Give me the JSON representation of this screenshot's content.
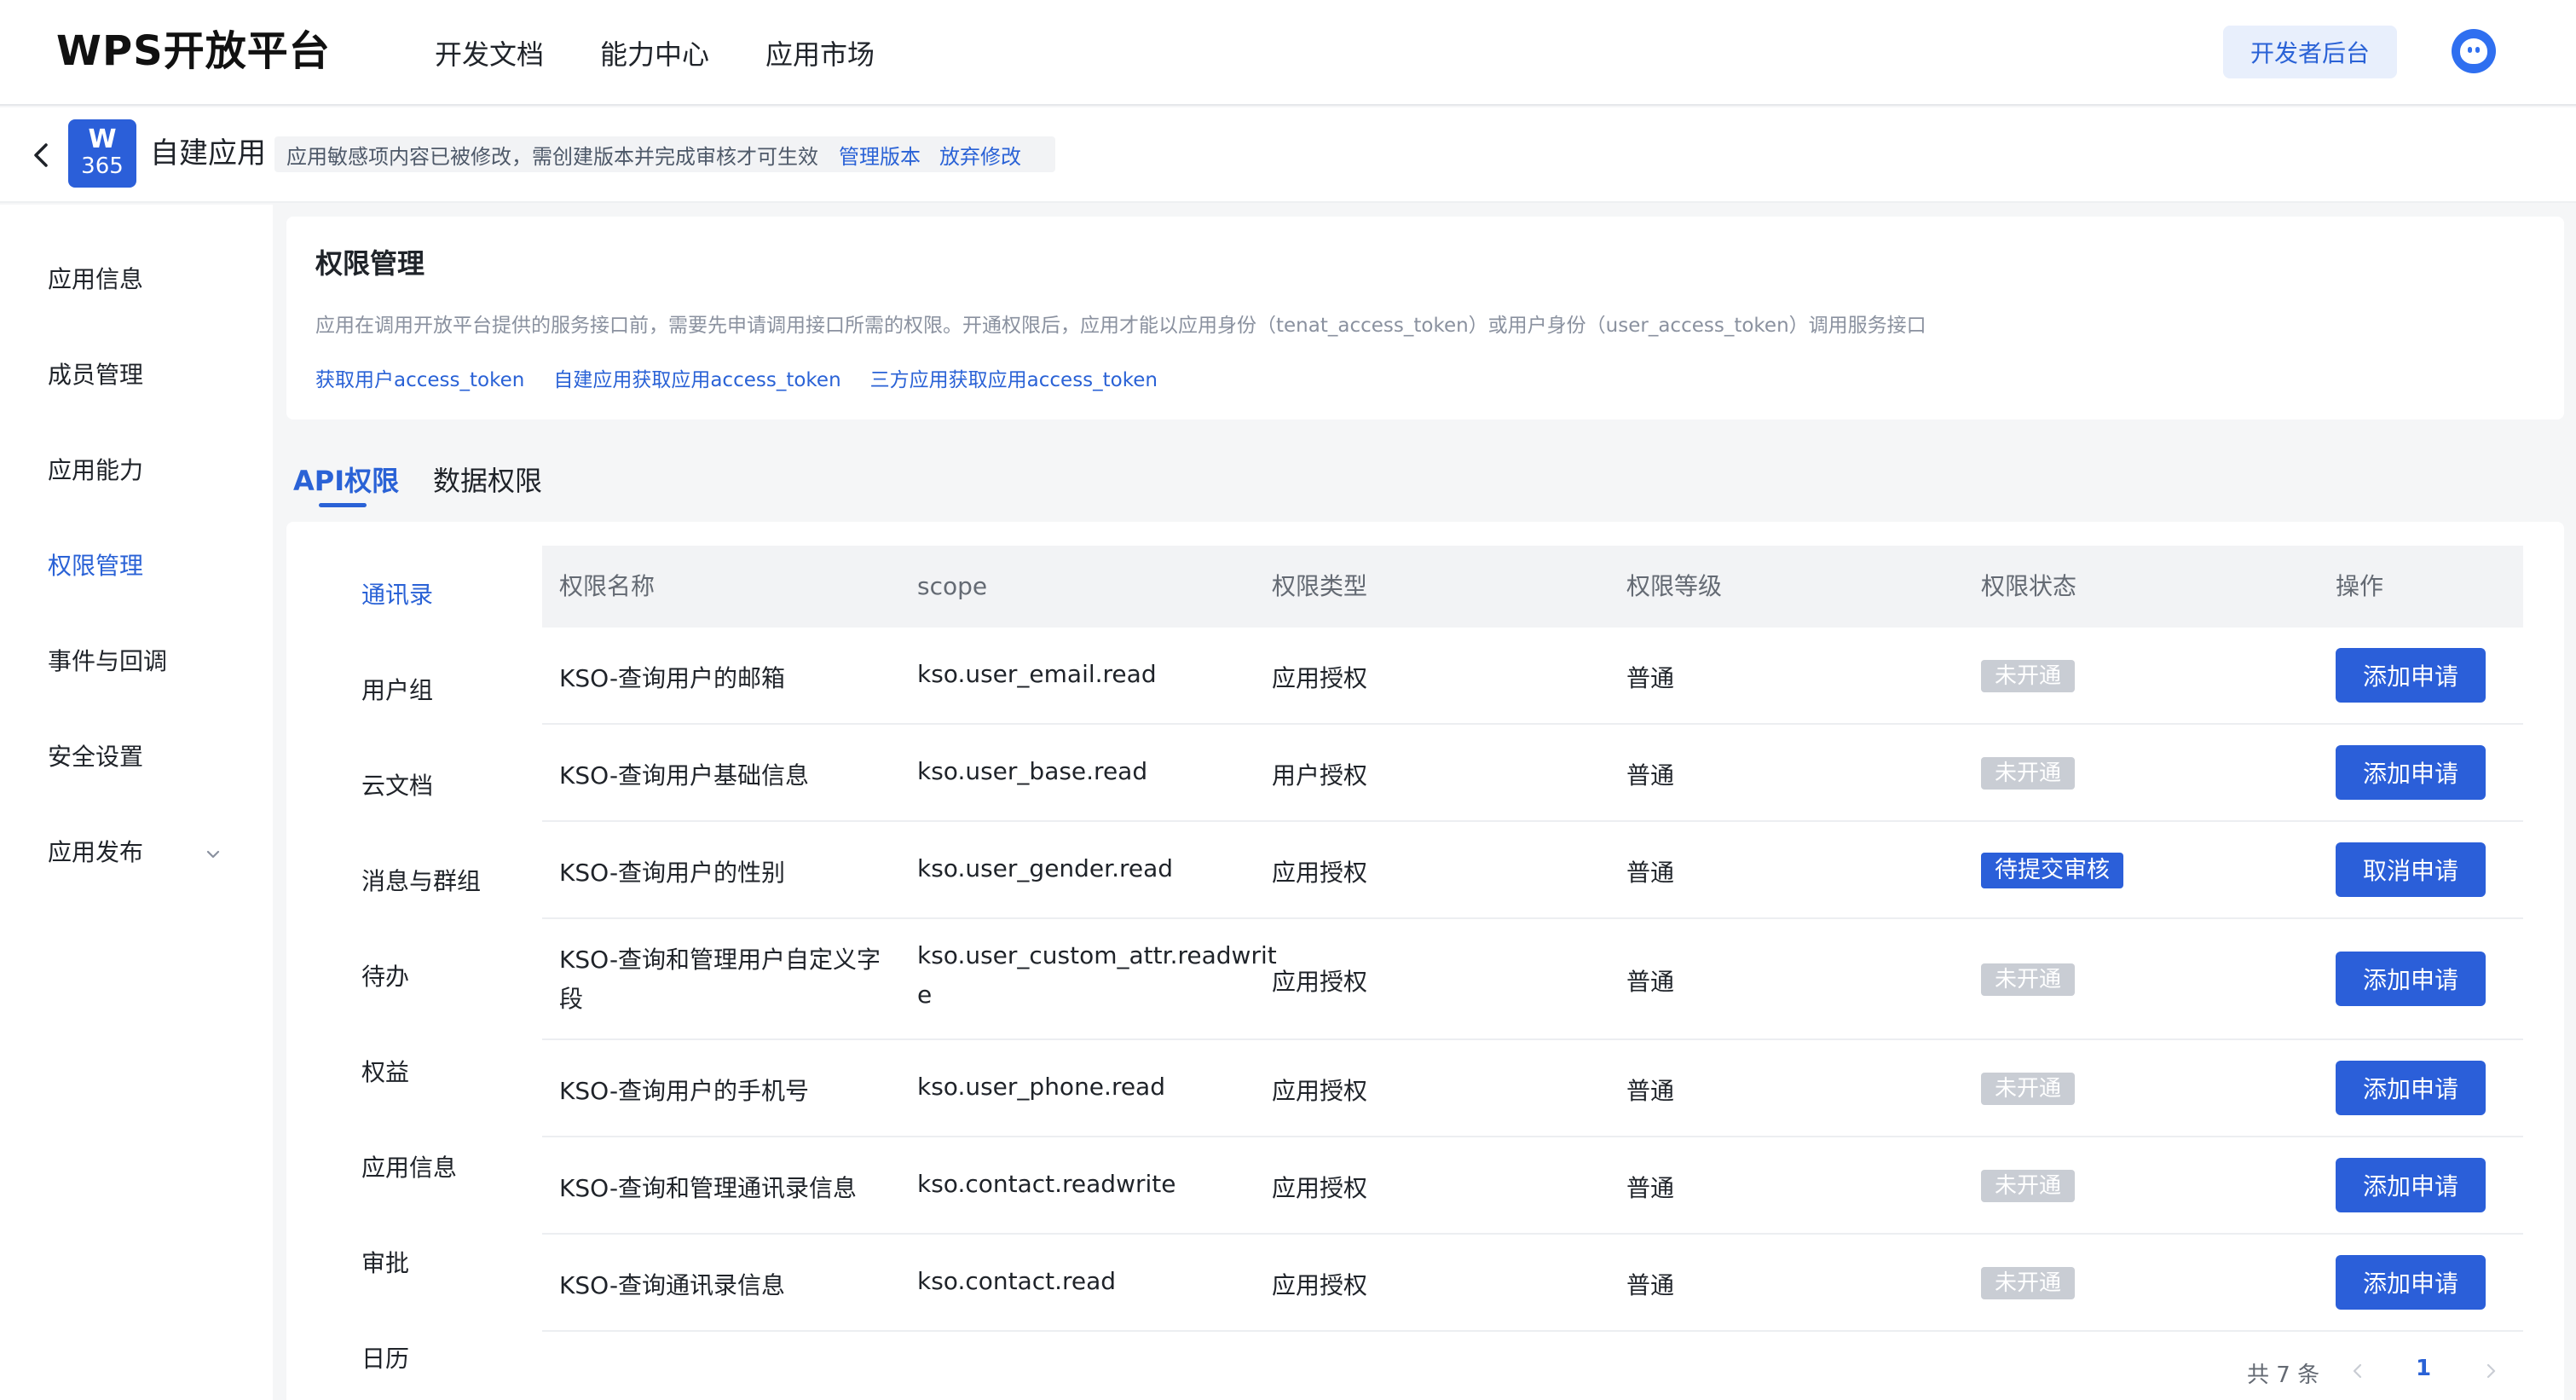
{
  "header": {
    "logo": "WPS开放平台",
    "nav": [
      "开发文档",
      "能力中心",
      "应用市场"
    ],
    "dev_console": "开发者后台"
  },
  "appbar": {
    "icon_top": "W",
    "icon_bottom": "365",
    "app_name": "自建应用",
    "notice": "应用敏感项内容已被修改，需创建版本并完成审核才可生效",
    "link_manage": "管理版本",
    "link_discard": "放弃修改"
  },
  "sidebar": {
    "items": [
      "应用信息",
      "成员管理",
      "应用能力",
      "权限管理",
      "事件与回调",
      "安全设置",
      "应用发布"
    ],
    "active": "权限管理"
  },
  "perm": {
    "title": "权限管理",
    "description": "应用在调用开放平台提供的服务接口前，需要先申请调用接口所需的权限。开通权限后，应用才能以应用身份（tenat_access_token）或用户身份（user_access_token）调用服务接口",
    "links": [
      "获取用户access_token",
      "自建应用获取应用access_token",
      "三方应用获取应用access_token"
    ]
  },
  "tabs": [
    "API权限",
    "数据权限"
  ],
  "categories": [
    "通讯录",
    "用户组",
    "云文档",
    "消息与群组",
    "待办",
    "权益",
    "应用信息",
    "审批",
    "日历"
  ],
  "table": {
    "headers": [
      "权限名称",
      "scope",
      "权限类型",
      "权限等级",
      "权限状态",
      "操作"
    ],
    "rows": [
      {
        "name": "KSO-查询用户的邮箱",
        "name2": "",
        "scope": "kso.user_email.read",
        "scope2": "",
        "type": "应用授权",
        "level": "普通",
        "status": "未开通",
        "action": "添加申请"
      },
      {
        "name": "KSO-查询用户基础信息",
        "name2": "",
        "scope": "kso.user_base.read",
        "scope2": "",
        "type": "用户授权",
        "level": "普通",
        "status": "未开通",
        "action": "添加申请"
      },
      {
        "name": "KSO-查询用户的性别",
        "name2": "",
        "scope": "kso.user_gender.read",
        "scope2": "",
        "type": "应用授权",
        "level": "普通",
        "status": "待提交审核",
        "action": "取消申请"
      },
      {
        "name": "KSO-查询和管理用户自定义字",
        "name2": "段",
        "scope": "kso.user_custom_attr.readwrit",
        "scope2": "e",
        "type": "应用授权",
        "level": "普通",
        "status": "未开通",
        "action": "添加申请"
      },
      {
        "name": "KSO-查询用户的手机号",
        "name2": "",
        "scope": "kso.user_phone.read",
        "scope2": "",
        "type": "应用授权",
        "level": "普通",
        "status": "未开通",
        "action": "添加申请"
      },
      {
        "name": "KSO-查询和管理通讯录信息",
        "name2": "",
        "scope": "kso.contact.readwrite",
        "scope2": "",
        "type": "应用授权",
        "level": "普通",
        "status": "未开通",
        "action": "添加申请"
      },
      {
        "name": "KSO-查询通讯录信息",
        "name2": "",
        "scope": "kso.contact.read",
        "scope2": "",
        "type": "应用授权",
        "level": "普通",
        "status": "未开通",
        "action": "添加申请"
      }
    ]
  },
  "pagination": {
    "total": "共 7 条",
    "current": "1"
  }
}
